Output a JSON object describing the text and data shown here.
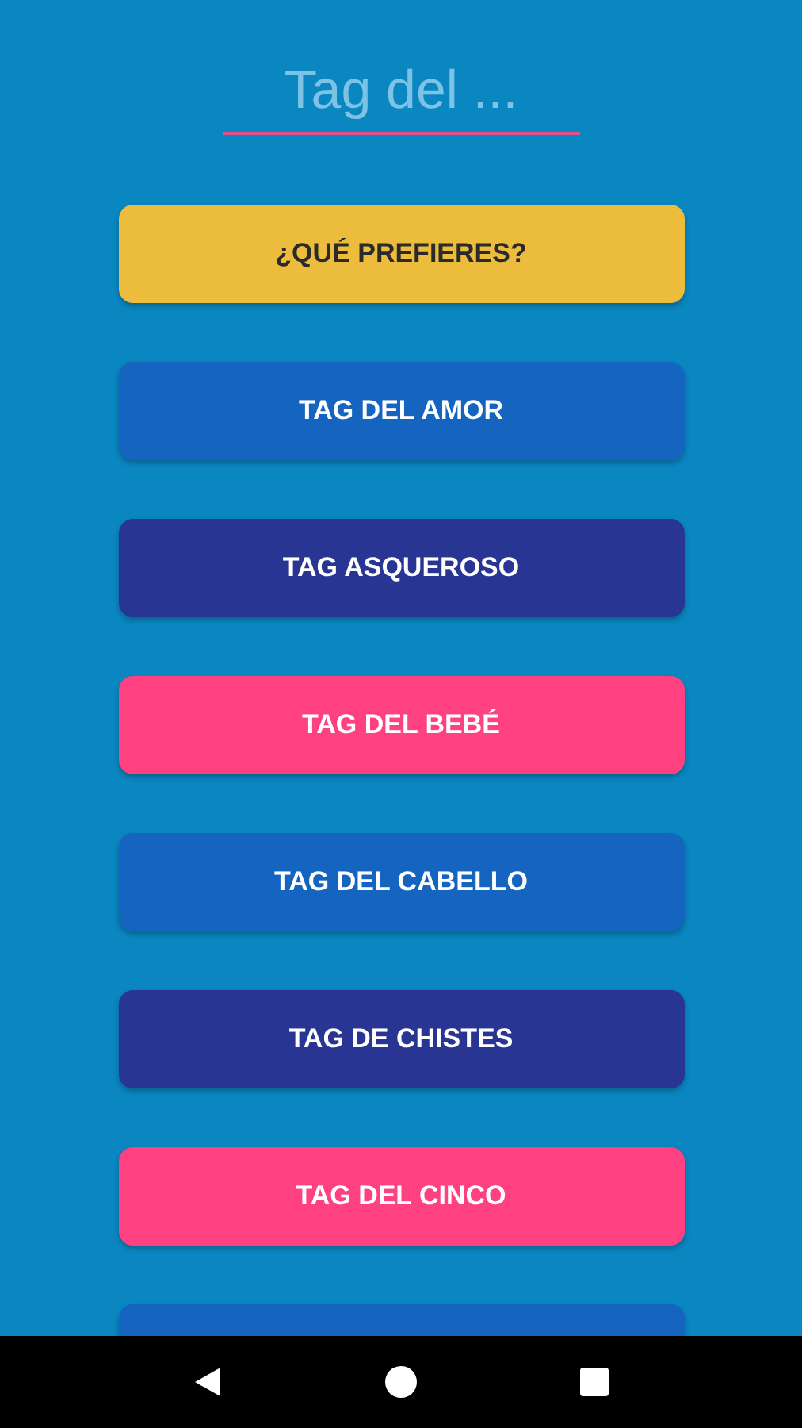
{
  "search": {
    "placeholder": "Tag del ..."
  },
  "buttons": [
    {
      "label": "¿QUÉ PREFIERES?",
      "color": "#ecbd3c"
    },
    {
      "label": "TAG DEL AMOR",
      "color": "#1565c0"
    },
    {
      "label": "TAG ASQUEROSO",
      "color": "#283593"
    },
    {
      "label": "TAG DEL BEBÉ",
      "color": "#ff4081"
    },
    {
      "label": "TAG DEL CABELLO",
      "color": "#1565c0"
    },
    {
      "label": "TAG DE CHISTES",
      "color": "#283593"
    },
    {
      "label": "TAG DEL CINCO",
      "color": "#ff4081"
    },
    {
      "color": "#1565c0"
    }
  ]
}
